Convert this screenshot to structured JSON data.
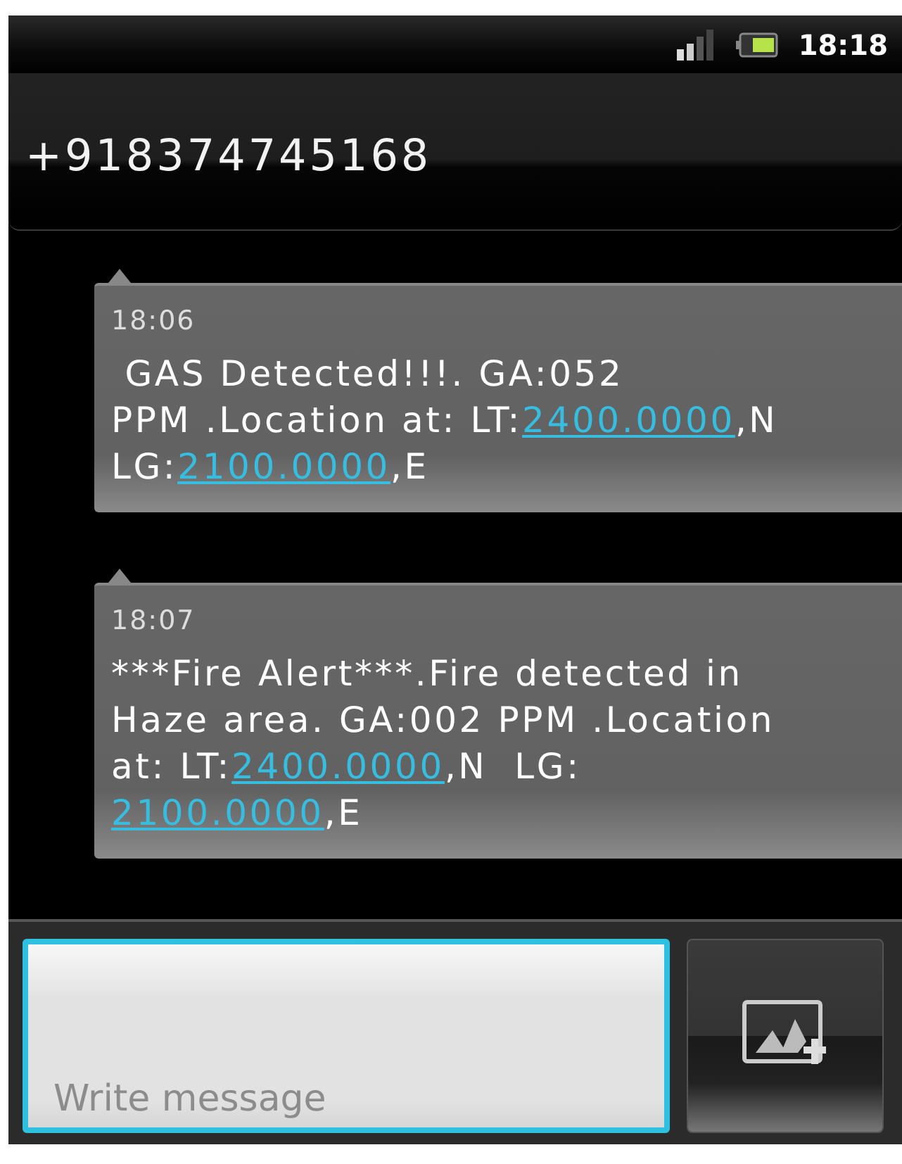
{
  "status_bar": {
    "time": "18:18"
  },
  "header": {
    "title": "+918374745168"
  },
  "messages": [
    {
      "time": "18:06",
      "lines": [
        [
          {
            "kind": "text",
            "text": " GAS Detected!!!. GA:052"
          }
        ],
        [
          {
            "kind": "text",
            "text": "PPM .Location at: LT:"
          },
          {
            "kind": "link",
            "text": "2400.0000"
          },
          {
            "kind": "text",
            "text": ",N"
          }
        ],
        [
          {
            "kind": "text",
            "text": "LG:"
          },
          {
            "kind": "link",
            "text": "2100.0000"
          },
          {
            "kind": "text",
            "text": ",E"
          }
        ]
      ]
    },
    {
      "time": "18:07",
      "lines": [
        [
          {
            "kind": "text",
            "text": "***Fire Alert***.Fire detected in"
          }
        ],
        [
          {
            "kind": "text",
            "text": "Haze area. GA:002 PPM .Location"
          }
        ],
        [
          {
            "kind": "text",
            "text": "at: LT:"
          },
          {
            "kind": "link",
            "text": "2400.0000"
          },
          {
            "kind": "text",
            "text": ",N  LG:"
          }
        ],
        [
          {
            "kind": "link",
            "text": "2100.0000"
          },
          {
            "kind": "text",
            "text": ",E"
          }
        ]
      ]
    }
  ],
  "composer": {
    "placeholder": "Write message",
    "focused": true
  }
}
